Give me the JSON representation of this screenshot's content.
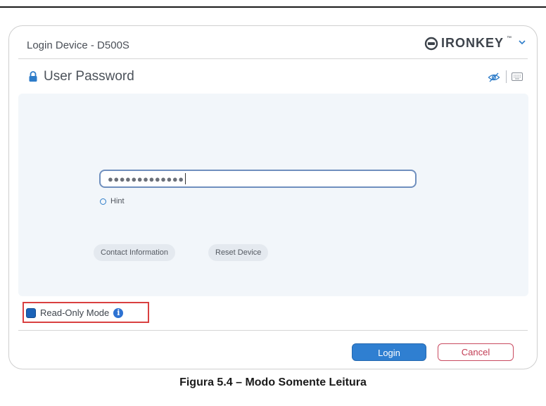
{
  "window": {
    "title": "Login Device - D500S"
  },
  "brand": {
    "name": "IRONKEY",
    "tm": "™",
    "logo_icon": "ironkey-logo-icon",
    "menu_icon": "chevron-down-icon"
  },
  "section": {
    "title": "User Password",
    "icon": "lock-icon",
    "visibility_icon": "eye-off-icon",
    "keyboard_icon": "keyboard-icon"
  },
  "password": {
    "value": "●●●●●●●●●●●●●"
  },
  "hint": {
    "label": "Hint"
  },
  "buttons": {
    "contact": "Contact Information",
    "reset": "Reset Device",
    "login": "Login",
    "cancel": "Cancel"
  },
  "read_only": {
    "label": "Read-Only Mode",
    "checked": true,
    "info_glyph": "i"
  },
  "caption": "Figura 5.4 – Modo Somente Leitura",
  "colors": {
    "accent": "#2f7fd1",
    "cancel": "#c23c54",
    "highlight": "#d94040",
    "panel": "#f2f6fa"
  }
}
